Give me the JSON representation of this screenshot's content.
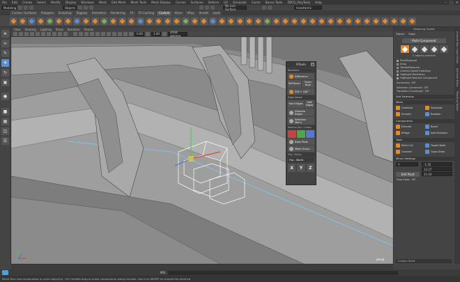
{
  "menubar": {
    "items": [
      "File",
      "Edit",
      "Create",
      "Select",
      "Modify",
      "Display",
      "Windows",
      "Mesh",
      "Edit Mesh",
      "Mesh Tools",
      "Mesh Display",
      "Curves",
      "Surfaces",
      "Deform",
      "UV",
      "Generate",
      "Cache",
      "Bonus Tools",
      "ZBCG_PolyTools",
      "Help"
    ]
  },
  "statusline": {
    "mode": "Modeling",
    "object_mode": "Objects",
    "live_surface": "No Live Surface",
    "transform_field": "transform1"
  },
  "shelf": {
    "tabs": [
      "Curves / Surfaces",
      "Polygons",
      "Sculpting",
      "Rigging",
      "Animation",
      "Rendering",
      "FX",
      "FX Caching",
      "Custom",
      "XGen",
      "VRay",
      "Arnold",
      "Load"
    ],
    "active_tab": "Custom"
  },
  "viewport": {
    "menu": [
      "View",
      "Shading",
      "Lighting",
      "Show",
      "Renderer",
      "Panels"
    ],
    "gamma_value": "1.00",
    "exposure_value": "0.00",
    "colorspace": "sRGB gamma",
    "camera_label": "persp"
  },
  "ktools": {
    "title": "KTools",
    "sections": {
      "booleans": "Booleans",
      "edge_select": "Edge Select",
      "normal_qty": "Normal Qty / Comp",
      "flip_mirror": "Flip / Mirror"
    },
    "buttons": {
      "difference": "Difference",
      "diff_bevel": "Diff Bevel",
      "clean_bool": "Clean Bool",
      "diff_180": "Diff + 180°",
      "hard_edges": "Hard Edges",
      "soft_edges": "Soft Edges",
      "dissolve_edges": "Dissolve Edges",
      "selection_menu": "Selection Menu",
      "bake_pivot": "Bake Pivot",
      "make_group": "Make Group",
      "flip_world": "Flip - World",
      "x": "X",
      "y": "Y",
      "z": "Z"
    }
  },
  "right_panel": {
    "header": "Modeling Toolkit",
    "tabs": [
      "Object",
      "Edge"
    ],
    "multi_component": "Multi-Component",
    "selection_info": "0 objects selected",
    "options": [
      {
        "label": "Pick/Marquee",
        "checked": true
      },
      {
        "label": "Drag",
        "checked": false
      },
      {
        "label": "Tweak/Marquee",
        "checked": false
      },
      {
        "label": "Camera Based Selection",
        "checked": false
      },
      {
        "label": "Highlight Backfaces",
        "checked": true
      },
      {
        "label": "Highlight Nearest Component",
        "checked": true
      }
    ],
    "symmetry_label": "Symmetry:",
    "symmetry_value": "Off",
    "selection_constraint_label": "Selection Constraint:",
    "selection_constraint_value": "Off",
    "transform_constraint_label": "Transform Constraint:",
    "transform_constraint_value": "Off",
    "soft_selection": "Soft Selection",
    "mesh_section": "Mesh",
    "mesh_buttons": [
      "Combine",
      "Separate",
      "Smooth",
      "Boolean"
    ],
    "components_section": "Components",
    "components_buttons": [
      "Extrude",
      "Bevel",
      "Bridge",
      "Add Divisions"
    ],
    "tools_section": "Tools",
    "tools_buttons": [
      "Multi-Cut",
      "Target Weld",
      "Connect",
      "Quad Draw"
    ],
    "mirror_section": "Mirror Settings",
    "mirror_axis": "Y",
    "mirror_fields": [
      "-1.35",
      "13.27",
      "21.03"
    ],
    "edit_pivot": "Edit Pivot",
    "step_snap_label": "Step Snap:",
    "step_snap_value": "Off",
    "footer": "Custom Shelf",
    "side_tabs": [
      "Channel Box / Layer Editor",
      "Attribute Editor",
      "Modeling Toolkit"
    ]
  },
  "commandline": {
    "mel": "MEL"
  },
  "helpline": {
    "text": "Move Tool: Use manipulator to move object(s). Ctrl+middle-drag to move components along normals. Use D or INSERT to change the pivot po"
  }
}
